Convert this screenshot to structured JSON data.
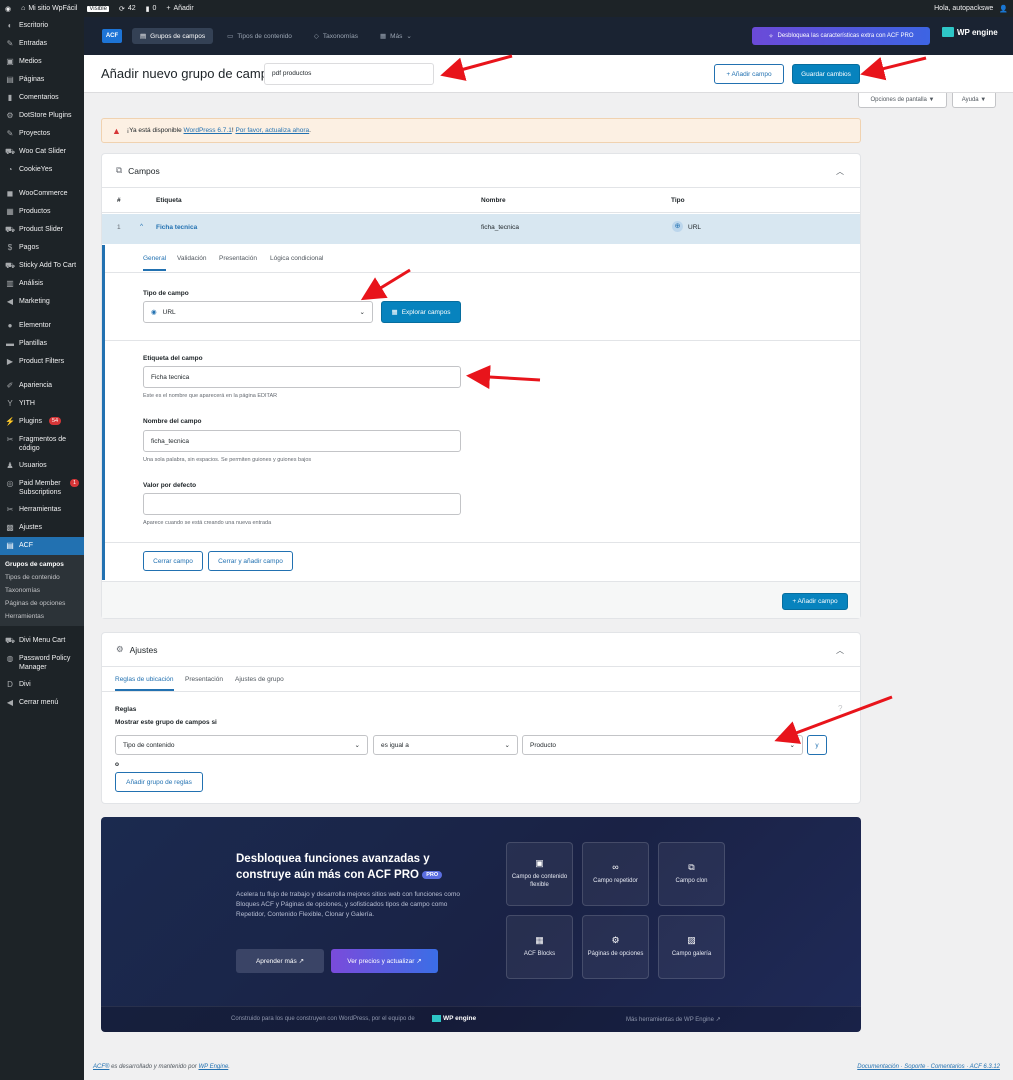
{
  "adminbar": {
    "site_name": "Mi sitio WpFácil",
    "visible_badge": "Visible",
    "updates_count": "42",
    "comments_count": "0",
    "add_new": "Añadir",
    "greeting": "Hola, autopackswe"
  },
  "sidebar": {
    "items": [
      {
        "label": "Escritorio",
        "icon": "dashboard-icon"
      },
      {
        "label": "Entradas",
        "icon": "pin-icon"
      },
      {
        "label": "Medios",
        "icon": "media-icon"
      },
      {
        "label": "Páginas",
        "icon": "page-icon"
      },
      {
        "label": "Comentarios",
        "icon": "comment-icon"
      },
      {
        "label": "DotStore Plugins",
        "icon": "gear-icon"
      },
      {
        "label": "Proyectos",
        "icon": "pin-icon"
      },
      {
        "label": "Woo Cat Slider",
        "icon": "cart-icon"
      },
      {
        "label": "CookieYes",
        "icon": "cookie-icon"
      },
      {
        "label": "WooCommerce",
        "icon": "woo-icon"
      },
      {
        "label": "Productos",
        "icon": "box-icon"
      },
      {
        "label": "Product Slider",
        "icon": "cart-icon"
      },
      {
        "label": "Pagos",
        "icon": "money-icon"
      },
      {
        "label": "Sticky Add To Cart",
        "icon": "cart-icon"
      },
      {
        "label": "Análisis",
        "icon": "chart-icon"
      },
      {
        "label": "Marketing",
        "icon": "megaphone-icon"
      },
      {
        "label": "Elementor",
        "icon": "elementor-icon"
      },
      {
        "label": "Plantillas",
        "icon": "folder-icon"
      },
      {
        "label": "Product Filters",
        "icon": "filter-icon"
      },
      {
        "label": "Apariencia",
        "icon": "brush-icon"
      },
      {
        "label": "YITH",
        "icon": "yith-icon"
      },
      {
        "label": "Plugins",
        "icon": "plugin-icon",
        "badge": "54"
      },
      {
        "label": "Fragmentos de código",
        "icon": "scissors-icon"
      },
      {
        "label": "Usuarios",
        "icon": "user-icon"
      },
      {
        "label": "Paid Member Subscriptions",
        "icon": "member-icon",
        "badge": "1"
      },
      {
        "label": "Herramientas",
        "icon": "wrench-icon"
      },
      {
        "label": "Ajustes",
        "icon": "settings-icon"
      },
      {
        "label": "ACF",
        "icon": "acf-icon"
      }
    ],
    "acf_sub": [
      "Grupos de campos",
      "Tipos de contenido",
      "Taxonomías",
      "Páginas de opciones",
      "Herramientas"
    ],
    "after": [
      {
        "label": "Divi Menu Cart",
        "icon": "cart-icon"
      },
      {
        "label": "Password Policy Manager",
        "icon": "shield-icon"
      },
      {
        "label": "Divi",
        "icon": "divi-icon"
      },
      {
        "label": "Cerrar menú",
        "icon": "collapse-icon"
      }
    ]
  },
  "acf_header": {
    "logo": "ACF",
    "tabs": [
      "Grupos de campos",
      "Tipos de contenido",
      "Taxonomías",
      "Más"
    ],
    "unlock": "Desbloquea las características extra con ACF PRO",
    "wpengine": "WP engine"
  },
  "title": {
    "heading": "Añadir nuevo grupo de campos",
    "group_name": "pdf productos",
    "add_field": "+ Añadir campo",
    "save": "Guardar cambios",
    "screen_options": "Opciones de pantalla ▼",
    "help": "Ayuda ▼"
  },
  "notice": {
    "pre": "¡Ya está disponible ",
    "link1": "WordPress 6.7.1",
    "mid": "! ",
    "link2": "Por favor, actualiza ahora",
    "post": "."
  },
  "campos": {
    "title": "Campos",
    "cols": [
      "#",
      "Etiqueta",
      "Nombre",
      "Tipo"
    ],
    "row": {
      "num": "1",
      "label": "Ficha tecnica",
      "name": "ficha_tecnica",
      "type": "URL"
    },
    "subtabs": [
      "General",
      "Validación",
      "Presentación",
      "Lógica condicional"
    ],
    "field_type_label": "Tipo de campo",
    "field_type_value": "URL",
    "explore": "Explorar campos",
    "label_label": "Etiqueta del campo",
    "label_value": "Ficha tecnica",
    "label_help": "Este es el nombre que aparecerá en la página EDITAR",
    "name_label": "Nombre del campo",
    "name_value": "ficha_tecnica",
    "name_help": "Una sola palabra, sin espacios. Se permiten guiones y guiones bajos",
    "default_label": "Valor por defecto",
    "default_help": "Aparece cuando se está creando una nueva entrada",
    "close": "Cerrar campo",
    "close_add": "Cerrar y añadir campo",
    "add_field": "+ Añadir campo"
  },
  "ajustes": {
    "title": "Ajustes",
    "tabs": [
      "Reglas de ubicación",
      "Presentación",
      "Ajustes de grupo"
    ],
    "rules": "Reglas",
    "show_if": "Mostrar este grupo de campos si",
    "param": "Tipo de contenido",
    "operator": "es igual a",
    "value": "Producto",
    "and": "y",
    "or": "o",
    "add_group": "Añadir grupo de reglas"
  },
  "promo": {
    "headline1": "Desbloquea funciones avanzadas y",
    "headline2": "construye aún más con ACF PRO",
    "pro": "PRO",
    "body": "Acelera tu flujo de trabajo y desarrolla mejores sitios web con funciones como Bloques ACF y Páginas de opciones, y sofisticados tipos de campo como Repetidor, Contenido Flexible, Clonar y Galería.",
    "learn": "Aprender más ↗",
    "pricing": "Ver precios y actualizar ↗",
    "cards": [
      {
        "label": "Campo de contenido flexible",
        "icon": "layout-icon"
      },
      {
        "label": "Campo repetidor",
        "icon": "infinity-icon"
      },
      {
        "label": "Campo clon",
        "icon": "clone-icon"
      },
      {
        "label": "ACF Blocks",
        "icon": "blocks-icon"
      },
      {
        "label": "Páginas de opciones",
        "icon": "gear-icon"
      },
      {
        "label": "Campo galería",
        "icon": "gallery-icon"
      }
    ],
    "built_by": "Construido para los que construyen con WordPress, por el equipo de",
    "built_brand": "WP engine",
    "more_tools": "Más herramientas de WP Engine ↗"
  },
  "footer": {
    "left_link1": "ACF®",
    "left_mid": " es desarrollado y mantenido por ",
    "left_link2": "WP Engine",
    "left_end": ".",
    "right": "Documentación · Soporte · Comentarios · ACF 6.3.12"
  }
}
